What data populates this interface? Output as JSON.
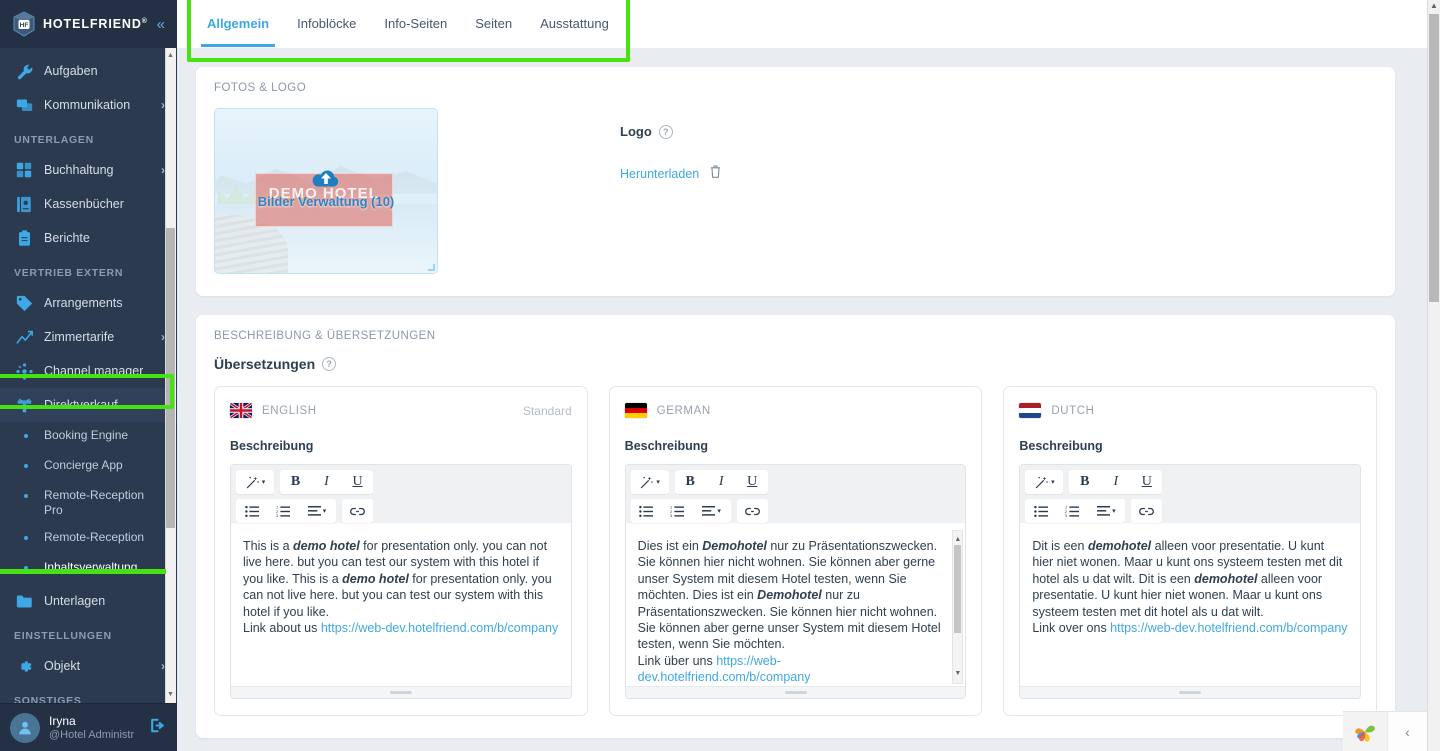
{
  "sidebar": {
    "brand": {
      "name": "HOTELFRIEND",
      "trademark": "®",
      "collapse_icon": "chevron-double-left"
    },
    "items": [
      {
        "label": "Aufgaben",
        "icon": "wrench-icon",
        "type": "item",
        "chevron": ""
      },
      {
        "label": "Kommunikation",
        "icon": "chat-icon",
        "type": "item",
        "chevron": "›"
      },
      {
        "label": "UNTERLAGEN",
        "type": "section"
      },
      {
        "label": "Buchhaltung",
        "icon": "calculator-icon",
        "type": "item",
        "chevron": "›"
      },
      {
        "label": "Kassenbücher",
        "icon": "book-icon",
        "type": "item",
        "chevron": ""
      },
      {
        "label": "Berichte",
        "icon": "clipboard-icon",
        "type": "item",
        "chevron": ""
      },
      {
        "label": "VERTRIEB EXTERN",
        "type": "section"
      },
      {
        "label": "Arrangements",
        "icon": "tag-icon",
        "type": "item",
        "chevron": ""
      },
      {
        "label": "Zimmertarife",
        "icon": "chart-icon",
        "type": "item",
        "chevron": "›"
      },
      {
        "label": "Channel manager",
        "icon": "network-icon",
        "type": "item",
        "chevron": ""
      },
      {
        "label": "Direktverkauf",
        "icon": "sell-icon",
        "type": "item",
        "chevron": "⌄",
        "active": true
      },
      {
        "label": "Booking Engine",
        "type": "sub"
      },
      {
        "label": "Concierge App",
        "type": "sub"
      },
      {
        "label": "Remote-Reception Pro",
        "type": "sub"
      },
      {
        "label": "Remote-Reception",
        "type": "sub"
      },
      {
        "label": "Inhaltsverwaltung",
        "type": "sub",
        "current": true
      },
      {
        "label": "Unterlagen",
        "icon": "folder-icon",
        "type": "item",
        "chevron": ""
      },
      {
        "label": "EINSTELLUNGEN",
        "type": "section"
      },
      {
        "label": "Objekt",
        "icon": "gear-icon",
        "type": "item",
        "chevron": "›"
      },
      {
        "label": "SONSTIGES",
        "type": "section"
      }
    ],
    "user": {
      "name": "Iryna",
      "role": "@Hotel Administr",
      "logout_icon": "logout-icon",
      "avatar_icon": "user-icon"
    }
  },
  "tabs": [
    {
      "label": "Allgemein",
      "active": true
    },
    {
      "label": "Infoblöcke",
      "active": false
    },
    {
      "label": "Info-Seiten",
      "active": false
    },
    {
      "label": "Seiten",
      "active": false
    },
    {
      "label": "Ausstattung",
      "active": false
    }
  ],
  "photos_card": {
    "title": "FOTOS & LOGO",
    "thumbnail": {
      "banner_text": "DEMO HOTEL",
      "caption": "Bilder Verwaltung (10)",
      "upload_icon": "cloud-upload-icon"
    },
    "logo": {
      "label": "Logo",
      "help_icon": "question-mark-icon",
      "download_label": "Herunterladen",
      "delete_icon": "trash-icon"
    }
  },
  "description_card": {
    "title": "BESCHREIBUNG & ÜBERSETZUNGEN",
    "subtitle": "Übersetzungen",
    "help_icon": "question-mark-icon",
    "field_label": "Beschreibung",
    "toolbar": {
      "magic_icon": "magic-wand-icon",
      "bold": "B",
      "italic": "I",
      "underline": "U",
      "bullet_list_icon": "bullet-list-icon",
      "numbered_list_icon": "numbered-list-icon",
      "align_icon": "align-icon",
      "link_icon": "link-icon",
      "caret": "▾"
    },
    "translations": [
      {
        "lang": "ENGLISH",
        "flag": "uk-flag",
        "badge": "Standard",
        "text_part1": "This is a ",
        "bold1": "demo hotel",
        "text_part2": " for presentation only. you can not live here. but you can test our system with this hotel if you like. This is a ",
        "bold2": "demo hotel",
        "text_part3": " for presentation only. you can not live here. but you can test our system with this hotel if you like.",
        "link_prefix": "Link about us ",
        "link": "https://web-dev.hotelfriend.com/b/company",
        "has_scrollbar": false
      },
      {
        "lang": "GERMAN",
        "flag": "de-flag",
        "badge": "",
        "text_part1": "Dies ist ein ",
        "bold1": "Demohotel",
        "text_part2": " nur zu Präsentationszwecken. Sie können hier nicht wohnen. Sie können aber gerne unser System mit diesem Hotel testen, wenn Sie möchten. Dies ist ein ",
        "bold2": "Demohotel",
        "text_part3": " nur zu Präsentationszwecken. Sie können hier nicht wohnen. Sie können aber gerne unser System mit diesem Hotel testen, wenn Sie möchten.",
        "link_prefix": "Link über uns ",
        "link": "https://web-dev.hotelfriend.com/b/company",
        "has_scrollbar": true
      },
      {
        "lang": "DUTCH",
        "flag": "nl-flag",
        "badge": "",
        "text_part1": "Dit is een ",
        "bold1": "demohotel",
        "text_part2": " alleen voor presentatie. U kunt hier niet wonen. Maar u kunt ons systeem testen met dit hotel als u dat wilt. Dit is een ",
        "bold2": "demohotel",
        "text_part3": " alleen voor presentatie. U kunt hier niet wonen. Maar u kunt ons systeem testen met dit hotel als u dat wilt.",
        "link_prefix": "Link over ons ",
        "link": "https://web-dev.hotelfriend.com/b/company",
        "has_scrollbar": false
      }
    ]
  },
  "bottom_widget": {
    "flower_icon": "pinwheel-icon",
    "collapse_icon": "chevron-left-icon"
  },
  "colors": {
    "accent": "#3ea8e5",
    "sidebar_bg": "#2b3a4f",
    "highlight": "#46e312",
    "page_bg": "#e9edf2"
  }
}
